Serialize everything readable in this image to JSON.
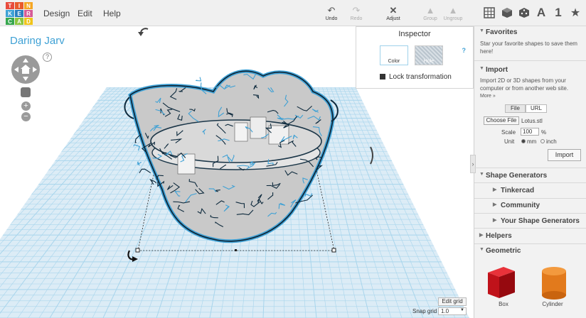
{
  "app": {
    "logo_letters": [
      "T",
      "I",
      "N",
      "K",
      "E",
      "R",
      "C",
      "A",
      "D"
    ],
    "logo_colors": [
      "#e84b3c",
      "#e85a2c",
      "#f5a623",
      "#3fa1d5",
      "#2a7fc0",
      "#d65b95",
      "#37a74f",
      "#8cc63f",
      "#f0c419"
    ],
    "menu": [
      "Design",
      "Edit",
      "Help"
    ]
  },
  "toolbar": {
    "undo": "Undo",
    "redo": "Redo",
    "adjust": "Adjust",
    "group": "Group",
    "ungroup": "Ungroup",
    "view_a": "A",
    "view_1": "1"
  },
  "workplane": {
    "title": "Daring Jarv",
    "help": "?",
    "zoom_in": "+",
    "zoom_out": "−",
    "grid_color": "#a8d5ec",
    "selection_color": "#3fa1d5"
  },
  "inspector": {
    "title": "Inspector",
    "color_label": "Color",
    "hole_label": "Hole",
    "help": "?",
    "lock_label": "Lock transformation"
  },
  "grid_controls": {
    "edit_grid": "Edit grid",
    "snap_label": "Snap grid",
    "snap_value": "1.0"
  },
  "sidebar": {
    "collapse_glyph": "›",
    "favorites": {
      "title": "Favorites",
      "text": "Star your favorite shapes to save them here!"
    },
    "import": {
      "title": "Import",
      "text": "Import 2D or 3D shapes from your computer or from another web site.",
      "more": "More »",
      "tab_file": "File",
      "tab_url": "URL",
      "choose_file": "Choose File",
      "file_name": "Lotus.stl",
      "scale_label": "Scale",
      "scale_value": "100",
      "scale_unit": "%",
      "unit_label": "Unit",
      "unit_mm": "mm",
      "unit_inch": "inch",
      "import_button": "Import"
    },
    "shape_generators": {
      "title": "Shape Generators",
      "items": [
        "Tinkercad",
        "Community",
        "Your Shape Generators"
      ]
    },
    "helpers": {
      "title": "Helpers"
    },
    "geometric": {
      "title": "Geometric",
      "shapes": [
        {
          "label": "Box",
          "color": "#d0161e"
        },
        {
          "label": "Cylinder",
          "color": "#e0771b"
        }
      ]
    }
  }
}
